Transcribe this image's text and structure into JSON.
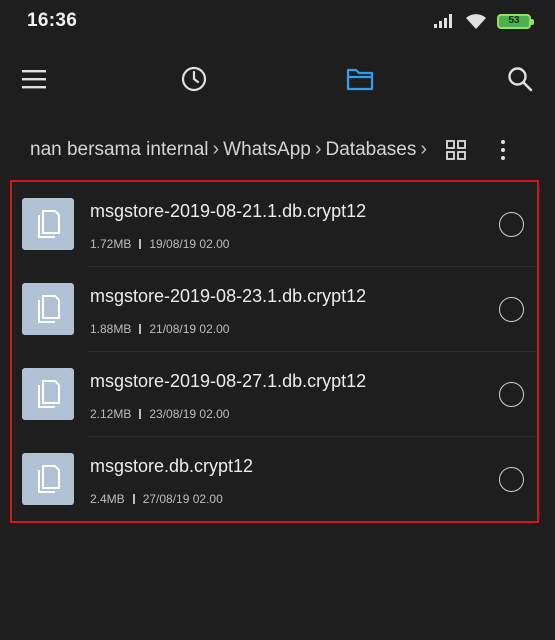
{
  "status_bar": {
    "time": "16:36",
    "battery_level": "53",
    "icons": [
      "signal-icon",
      "wifi-icon",
      "battery-icon"
    ]
  },
  "toolbar": {
    "items": [
      "menu-icon",
      "recent-icon",
      "folder-icon",
      "search-icon"
    ],
    "active_color": "#2d9ef0"
  },
  "breadcrumb": {
    "segments": [
      "nan bersama internal",
      "WhatsApp",
      "Databases"
    ]
  },
  "files": [
    {
      "name": "msgstore-2019-08-21.1.db.crypt12",
      "size": "1.72MB",
      "date": "19/08/19 02.00"
    },
    {
      "name": "msgstore-2019-08-23.1.db.crypt12",
      "size": "1.88MB",
      "date": "21/08/19 02.00"
    },
    {
      "name": "msgstore-2019-08-27.1.db.crypt12",
      "size": "2.12MB",
      "date": "23/08/19 02.00"
    },
    {
      "name": "msgstore.db.crypt12",
      "size": "2.4MB",
      "date": "27/08/19 02.00"
    }
  ],
  "colors": {
    "background": "#1e1e1f",
    "highlight_border": "#d9131b",
    "thumb": "#b1c2d6"
  }
}
